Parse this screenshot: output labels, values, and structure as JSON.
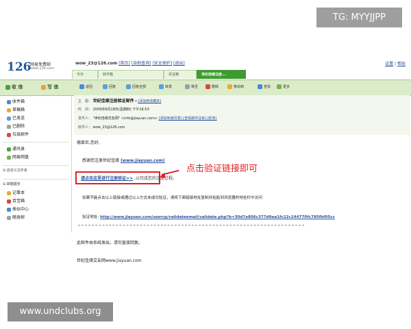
{
  "watermarks": {
    "top": "TG: MYYJJPP",
    "bottom": "www.undclubs.org"
  },
  "header": {
    "logo": "126",
    "logo_title": "网易免费邮",
    "logo_url": "www.126.com",
    "account": "wow_23@126.com",
    "account_links": [
      "[首页]",
      "[自助查询]",
      "[安全保护]",
      "[退出]"
    ],
    "top_links": [
      "设置",
      "帮助"
    ]
  },
  "tabs": [
    {
      "label": "今日"
    },
    {
      "label": "收件箱"
    },
    {
      "label": "百宝箱"
    },
    {
      "label": "世纪佳缘注册..."
    }
  ],
  "toolbar": {
    "compose_inbox": "收 信",
    "compose_write": "写 信",
    "actions": [
      "返回",
      "回复",
      "回复全部",
      "转发",
      "移至",
      "删除",
      "移动到",
      "查找",
      "更多"
    ]
  },
  "sidebar": {
    "folders": [
      "收件箱",
      "草稿箱",
      "已发送",
      "已删除",
      "垃圾邮件"
    ],
    "extras": [
      "通讯录",
      "网易网盘"
    ],
    "custom_section": "自定义文件夹",
    "services_section": "邮箱服务",
    "services": [
      "记事本",
      "百宝箱",
      "类似中心",
      "随身邮"
    ]
  },
  "mail": {
    "subject_label": "主　题：",
    "subject": "世纪佳缘注册验证邮件",
    "subject_links": "[添加到收藏夹]",
    "time_label": "时　间：",
    "time": "2009年6月18日(星期四) 下午16:53",
    "from_label": "发件人：",
    "from": "\"世纪佳缘交友网\" <info@jiayuan.com>",
    "from_links": "[添加到通讯录] [查看邮件往来] [拒收]",
    "to_label": "收件人：",
    "to": "wow_23@126.com",
    "greeting": "德莱尼,您好,",
    "thanks": "感谢您注册世纪佳缘",
    "thanks_link": "(www.jiayuan.com)",
    "action_link": "请点击这里进行注册验证>>",
    "action_suffix": ",以完成您的注册过程。",
    "annotation": "点击验证链接即可",
    "fallback": "如果不能点击以上链接或通过以上方式未成功验证，请将下面链接地址复制并粘贴到浏览器的地址栏中访问",
    "verify_label": "验证地址:",
    "verify_url": "http://www.jiayuan.com/usercp/validateemail/validate.php?b=30d7e806c377d9aa1fc22c244770fc785fbf05cc",
    "auto_note": "此邮件由系统发出，请勿直接回复。",
    "signature": "世纪佳缘交友网www.jiayuan.com"
  },
  "colors": {
    "brand_green": "#3f9b2f",
    "link_blue": "#2a4fa0",
    "annotation_red": "#e02020"
  }
}
